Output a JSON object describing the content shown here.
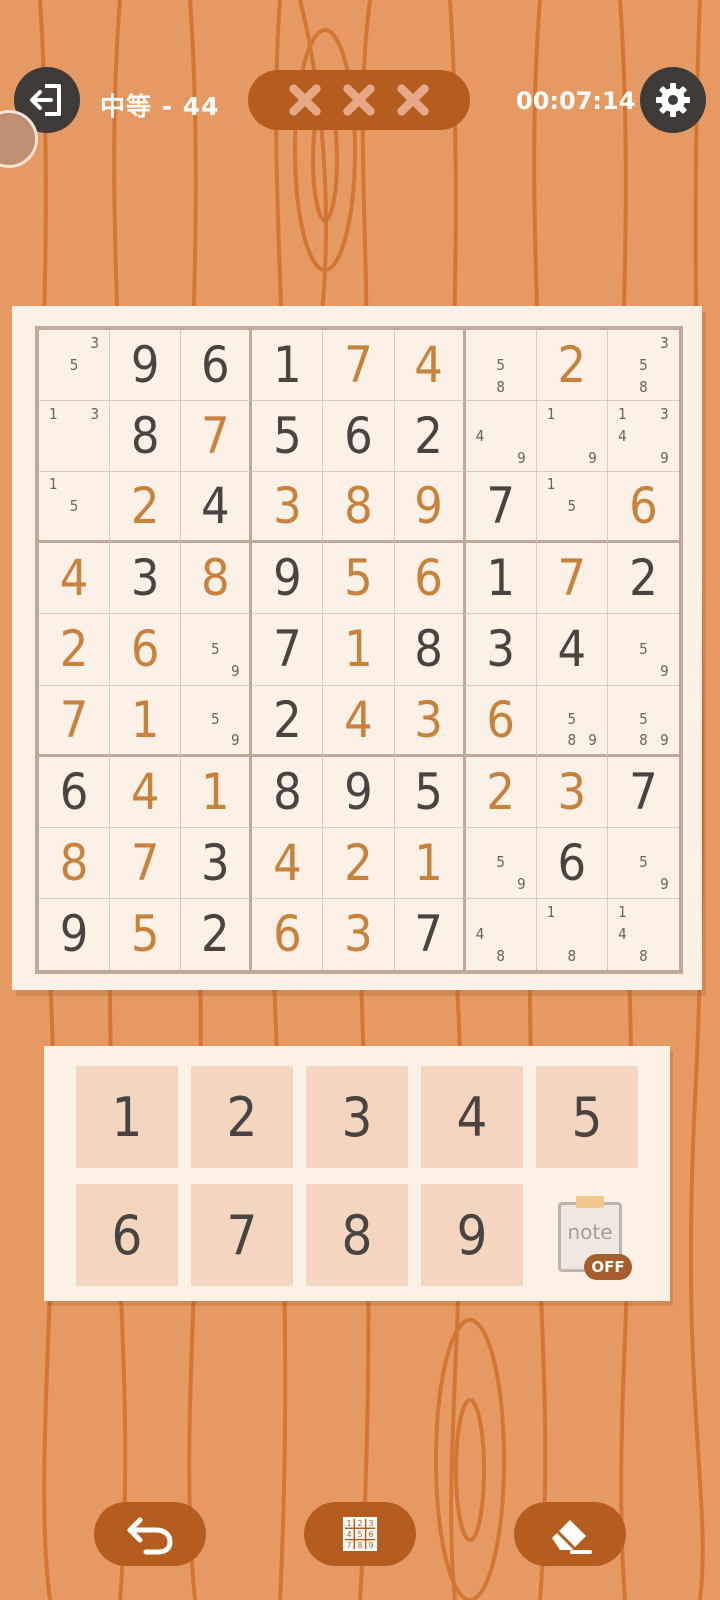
{
  "header": {
    "level_label": "中等 - 44",
    "mistakes": [
      "x",
      "x",
      "x"
    ],
    "timer": "00:07:14",
    "exit_icon": "exit-icon",
    "settings_icon": "gear-icon"
  },
  "board": {
    "cells": [
      [
        {
          "n": [
            3,
            5
          ]
        },
        {
          "v": "9",
          "t": "g"
        },
        {
          "v": "6",
          "t": "g"
        },
        {
          "v": "1",
          "t": "g"
        },
        {
          "v": "7",
          "t": "e"
        },
        {
          "v": "4",
          "t": "e"
        },
        {
          "n": [
            5,
            8
          ]
        },
        {
          "v": "2",
          "t": "e"
        },
        {
          "n": [
            3,
            5,
            8
          ]
        }
      ],
      [
        {
          "n": [
            1,
            3
          ]
        },
        {
          "v": "8",
          "t": "g"
        },
        {
          "v": "7",
          "t": "e"
        },
        {
          "v": "5",
          "t": "g"
        },
        {
          "v": "6",
          "t": "g"
        },
        {
          "v": "2",
          "t": "g"
        },
        {
          "n": [
            4,
            9
          ]
        },
        {
          "n": [
            1,
            9
          ]
        },
        {
          "n": [
            1,
            3,
            4,
            9
          ]
        }
      ],
      [
        {
          "n": [
            1,
            5
          ]
        },
        {
          "v": "2",
          "t": "e"
        },
        {
          "v": "4",
          "t": "g"
        },
        {
          "v": "3",
          "t": "e"
        },
        {
          "v": "8",
          "t": "e"
        },
        {
          "v": "9",
          "t": "e"
        },
        {
          "v": "7",
          "t": "g"
        },
        {
          "n": [
            1,
            5
          ]
        },
        {
          "v": "6",
          "t": "e"
        }
      ],
      [
        {
          "v": "4",
          "t": "e"
        },
        {
          "v": "3",
          "t": "g"
        },
        {
          "v": "8",
          "t": "e"
        },
        {
          "v": "9",
          "t": "g"
        },
        {
          "v": "5",
          "t": "e"
        },
        {
          "v": "6",
          "t": "e"
        },
        {
          "v": "1",
          "t": "g"
        },
        {
          "v": "7",
          "t": "e"
        },
        {
          "v": "2",
          "t": "g"
        }
      ],
      [
        {
          "v": "2",
          "t": "e"
        },
        {
          "v": "6",
          "t": "e"
        },
        {
          "n": [
            5,
            9
          ]
        },
        {
          "v": "7",
          "t": "g"
        },
        {
          "v": "1",
          "t": "e"
        },
        {
          "v": "8",
          "t": "g"
        },
        {
          "v": "3",
          "t": "g"
        },
        {
          "v": "4",
          "t": "g"
        },
        {
          "n": [
            5,
            9
          ]
        }
      ],
      [
        {
          "v": "7",
          "t": "e"
        },
        {
          "v": "1",
          "t": "e"
        },
        {
          "n": [
            5,
            9
          ]
        },
        {
          "v": "2",
          "t": "g"
        },
        {
          "v": "4",
          "t": "e"
        },
        {
          "v": "3",
          "t": "e"
        },
        {
          "v": "6",
          "t": "e"
        },
        {
          "n": [
            5,
            8,
            9
          ]
        },
        {
          "n": [
            5,
            8,
            9
          ]
        }
      ],
      [
        {
          "v": "6",
          "t": "g"
        },
        {
          "v": "4",
          "t": "e"
        },
        {
          "v": "1",
          "t": "e"
        },
        {
          "v": "8",
          "t": "g"
        },
        {
          "v": "9",
          "t": "g"
        },
        {
          "v": "5",
          "t": "g"
        },
        {
          "v": "2",
          "t": "e"
        },
        {
          "v": "3",
          "t": "e"
        },
        {
          "v": "7",
          "t": "g"
        }
      ],
      [
        {
          "v": "8",
          "t": "e"
        },
        {
          "v": "7",
          "t": "e"
        },
        {
          "v": "3",
          "t": "g"
        },
        {
          "v": "4",
          "t": "e"
        },
        {
          "v": "2",
          "t": "e"
        },
        {
          "v": "1",
          "t": "e"
        },
        {
          "n": [
            5,
            9
          ]
        },
        {
          "v": "6",
          "t": "g"
        },
        {
          "n": [
            5,
            9
          ]
        }
      ],
      [
        {
          "v": "9",
          "t": "g"
        },
        {
          "v": "5",
          "t": "e"
        },
        {
          "v": "2",
          "t": "g"
        },
        {
          "v": "6",
          "t": "e"
        },
        {
          "v": "3",
          "t": "e"
        },
        {
          "v": "7",
          "t": "g"
        },
        {
          "n": [
            4,
            8
          ]
        },
        {
          "n": [
            1,
            8
          ]
        },
        {
          "n": [
            1,
            4,
            8
          ]
        }
      ]
    ]
  },
  "keypad": {
    "digits": [
      "1",
      "2",
      "3",
      "4",
      "5",
      "6",
      "7",
      "8",
      "9"
    ],
    "note_label": "note",
    "note_state": "OFF"
  },
  "bottom_bar": {
    "undo_icon": "undo-icon",
    "autonote_icon": "auto-notes-icon",
    "erase_icon": "eraser-icon"
  },
  "colors": {
    "background": "#e49a62",
    "given_digit": "#4a4441",
    "entered_digit": "#c7823e",
    "accent_pill": "#b45d1e"
  }
}
